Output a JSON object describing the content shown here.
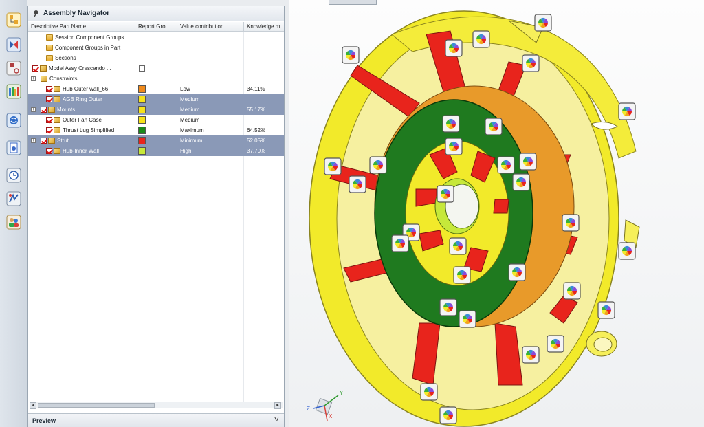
{
  "navigator": {
    "title": "Assembly Navigator",
    "columns": [
      "Descriptive Part Name",
      "Report Gro...",
      "Value contribution",
      "Knowledge m"
    ],
    "rows": [
      {
        "label": "Session Component Groups",
        "type": "folder",
        "swatch": "",
        "value": "",
        "knowledge": "",
        "selected": false
      },
      {
        "label": "Component Groups in Part",
        "type": "folder",
        "swatch": "",
        "value": "",
        "knowledge": "",
        "selected": false
      },
      {
        "label": "Sections",
        "type": "folder",
        "swatch": "",
        "value": "",
        "knowledge": "",
        "selected": false
      },
      {
        "label": "Model Assy Crescendo ...",
        "type": "assembly",
        "swatch": "",
        "value": "",
        "knowledge": "",
        "selected": false
      },
      {
        "label": "Constraints",
        "type": "constraints",
        "swatch": "",
        "value": "",
        "knowledge": "",
        "selected": false
      },
      {
        "label": "Hub Outer wall_66",
        "type": "part",
        "swatch": "#f08a1c",
        "value": "Low",
        "knowledge": "34.11%",
        "selected": false
      },
      {
        "label": "AGB Ring Outer",
        "type": "part",
        "swatch": "#f6e21a",
        "value": "Medium",
        "knowledge": "",
        "selected": true
      },
      {
        "label": "Mounts",
        "type": "part",
        "swatch": "#f6e21a",
        "value": "Medium",
        "knowledge": "55.17%",
        "selected": true
      },
      {
        "label": "Outer Fan Case",
        "type": "part",
        "swatch": "#f6e21a",
        "value": "Medium",
        "knowledge": "",
        "selected": false
      },
      {
        "label": "Thrust Lug Simplified",
        "type": "part",
        "swatch": "#1a8a1a",
        "value": "Maximum",
        "knowledge": "64.52%",
        "selected": false
      },
      {
        "label": "Strut",
        "type": "part",
        "swatch": "#e8241c",
        "value": "Minimum",
        "knowledge": "52.05%",
        "selected": true
      },
      {
        "label": "Hub-Inner Wall",
        "type": "part",
        "swatch": "#c6e83a",
        "value": "High",
        "knowledge": "37.70%",
        "selected": true
      }
    ]
  },
  "preview": {
    "label": "Preview",
    "chevron": "V"
  },
  "colors": {
    "selection": "#8a99b7",
    "outer_case": "#f2ea2a",
    "strut": "#e8241c",
    "hub_green": "#1f7a1f",
    "hub_orange": "#e89a2a"
  },
  "icons": [
    "assembly-navigator-icon",
    "constraint-navigator-icon",
    "part-navigator-icon",
    "reuse-library-icon",
    "web-browser-icon",
    "history-icon",
    "process-studio-icon",
    "roles-icon",
    "knowledge-pie-icon"
  ],
  "axis": {
    "x": "X",
    "y": "Y",
    "z": "Z"
  }
}
